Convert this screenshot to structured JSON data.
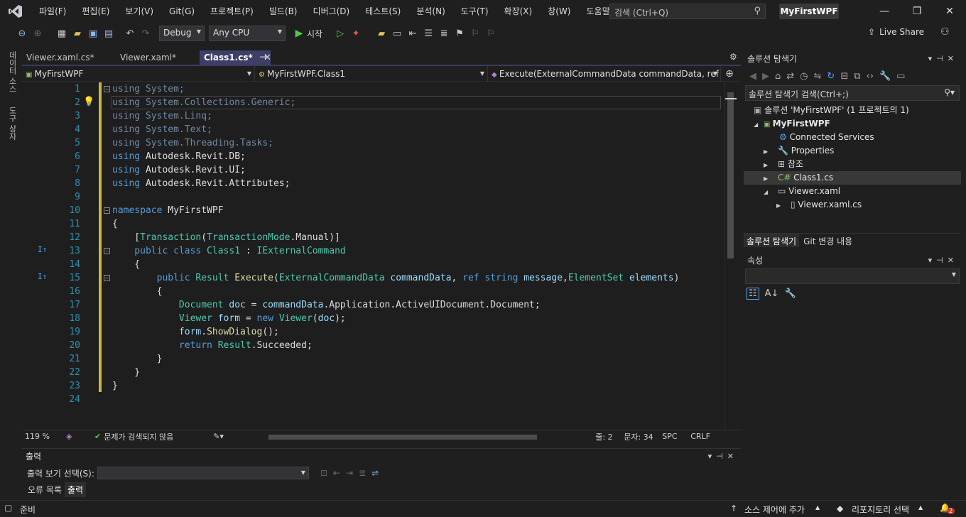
{
  "menubar": {
    "items": [
      "파일(F)",
      "편집(E)",
      "보기(V)",
      "Git(G)",
      "프로젝트(P)",
      "빌드(B)",
      "디버그(D)",
      "테스트(S)",
      "분석(N)",
      "도구(T)",
      "확장(X)",
      "창(W)",
      "도움말(H)"
    ],
    "search_placeholder": "검색 (Ctrl+Q)",
    "project_name": "MyFirstWPF"
  },
  "toolbar": {
    "config": "Debug",
    "platform": "Any CPU",
    "start_label": "시작",
    "live_share": "Live Share"
  },
  "left_rail": {
    "items": [
      "데이터 소스",
      "도구 상자"
    ]
  },
  "tabs": [
    {
      "label": "Viewer.xaml.cs*",
      "active": false
    },
    {
      "label": "Viewer.xaml*",
      "active": false
    },
    {
      "label": "Class1.cs*",
      "active": true
    }
  ],
  "navbar": {
    "project": "MyFirstWPF",
    "type": "MyFirstWPF.Class1",
    "member": "Execute(ExternalCommandData commandData, ref str"
  },
  "editor": {
    "line_numbers": [
      "1",
      "2",
      "3",
      "4",
      "5",
      "6",
      "7",
      "8",
      "9",
      "10",
      "11",
      "12",
      "13",
      "14",
      "15",
      "16",
      "17",
      "18",
      "19",
      "20",
      "21",
      "22",
      "23",
      "24"
    ]
  },
  "statusrow": {
    "zoom": "119 %",
    "issues": "문제가 검색되지 않음",
    "line": "줄: 2",
    "col": "문자: 34",
    "spc": "SPC",
    "eol": "CRLF"
  },
  "output": {
    "title": "출력",
    "source_label": "출력 보기 선택(S):",
    "tabs": [
      "오류 목록",
      "출력"
    ]
  },
  "solution": {
    "title": "솔루션 탐색기",
    "search_placeholder": "솔루션 탐색기 검색(Ctrl+;)",
    "root": "솔루션 'MyFirstWPF' (1 프로젝트의 1)",
    "project": "MyFirstWPF",
    "items": [
      "Connected Services",
      "Properties",
      "참조",
      "Class1.cs",
      "Viewer.xaml",
      "Viewer.xaml.cs"
    ],
    "bottom_tabs": [
      "솔루션 탐색기",
      "Git 변경 내용"
    ]
  },
  "properties": {
    "title": "속성"
  },
  "bottombar": {
    "status": "준비",
    "source_control": "소스 제어에 추가",
    "repo": "리포지토리 선택",
    "notifications": "2"
  },
  "colors": {
    "accent": "#3e3e68",
    "keyword": "#569cd6",
    "type": "#4ec9b0",
    "line_number": "#2b91af"
  }
}
